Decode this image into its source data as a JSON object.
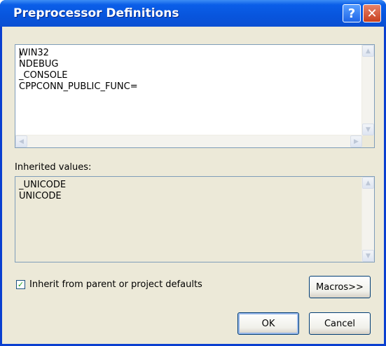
{
  "window": {
    "title": "Preprocessor Definitions",
    "help_glyph": "?",
    "close_glyph": "✕"
  },
  "definitions": {
    "lines": [
      "WIN32",
      "NDEBUG",
      "_CONSOLE",
      "CPPCONN_PUBLIC_FUNC="
    ]
  },
  "inherited": {
    "label": "Inherited values:",
    "lines": [
      "_UNICODE",
      "UNICODE"
    ]
  },
  "inherit_checkbox": {
    "label": "Inherit from parent or project defaults",
    "checked": true,
    "check_glyph": "✓"
  },
  "buttons": {
    "macros": "Macros>>",
    "ok": "OK",
    "cancel": "Cancel"
  },
  "scroll_glyphs": {
    "up": "▲",
    "down": "▼",
    "left": "◀",
    "right": "▶"
  },
  "colors": {
    "titlebar": "#0a5ee8",
    "dialog_bg": "#ece9d8",
    "inherited_bg": "#ece9d8"
  }
}
